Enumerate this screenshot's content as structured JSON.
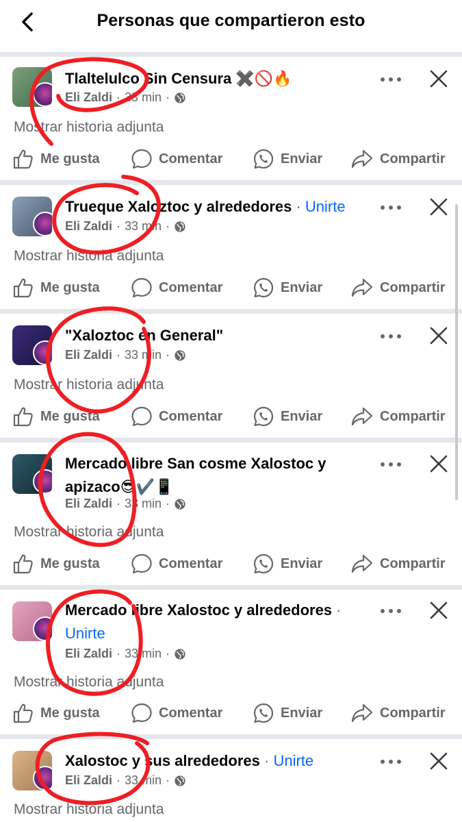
{
  "header": {
    "title": "Personas que compartieron esto"
  },
  "shares": [
    {
      "group": "Tlaltelulco Sin Censura ✖️🚫🔥",
      "join": "",
      "author": "Eli Zaldi",
      "time": "33 min",
      "story": "Mostrar historia adjunta",
      "thumb": [
        "#7fa07a",
        "#3f6b4f"
      ]
    },
    {
      "group": "Trueque Xaloztoc y alrededores",
      "join": "Unirte",
      "author": "Eli Zaldi",
      "time": "33 min",
      "story": "Mostrar historia adjunta",
      "thumb": [
        "#8aa0b8",
        "#4a5a6e"
      ]
    },
    {
      "group": "\"Xaloztoc en General\"",
      "join": "",
      "author": "Eli Zaldi",
      "time": "33 min",
      "story": "Mostrar historia adjunta",
      "thumb": [
        "#3b2a7a",
        "#1a1440"
      ]
    },
    {
      "group": "Mercado libre San cosme Xalostoc y apizaco😎✔️📱",
      "join": "",
      "author": "Eli Zaldi",
      "time": "33 min",
      "story": "Mostrar historia adjunta",
      "thumb": [
        "#2c5a6a",
        "#142a33"
      ]
    },
    {
      "group": "Mercado libre  Xalostoc y alrededores",
      "join": "Unirte",
      "author": "Eli Zaldi",
      "time": "33 min",
      "story": "Mostrar historia adjunta",
      "thumb": [
        "#e3a6c0",
        "#b86d8f"
      ]
    },
    {
      "group": "Xalostoc y sus alrededores",
      "join": "Unirte",
      "author": "Eli Zaldi",
      "time": "33 min",
      "story": "Mostrar historia adjunta",
      "thumb": [
        "#d9b48a",
        "#a67f52"
      ]
    }
  ],
  "actions": {
    "like": "Me gusta",
    "comment": "Comentar",
    "send": "Enviar",
    "share": "Compartir"
  },
  "icons": [
    "back-arrow-icon",
    "more-dots-icon",
    "close-icon",
    "globe-icon",
    "thumbs-up-icon",
    "comment-bubble-icon",
    "whatsapp-icon",
    "share-arrow-icon"
  ],
  "colors": {
    "link": "#0866ff",
    "secondary_text": "#65676b",
    "annotation": "#ee1f24"
  }
}
